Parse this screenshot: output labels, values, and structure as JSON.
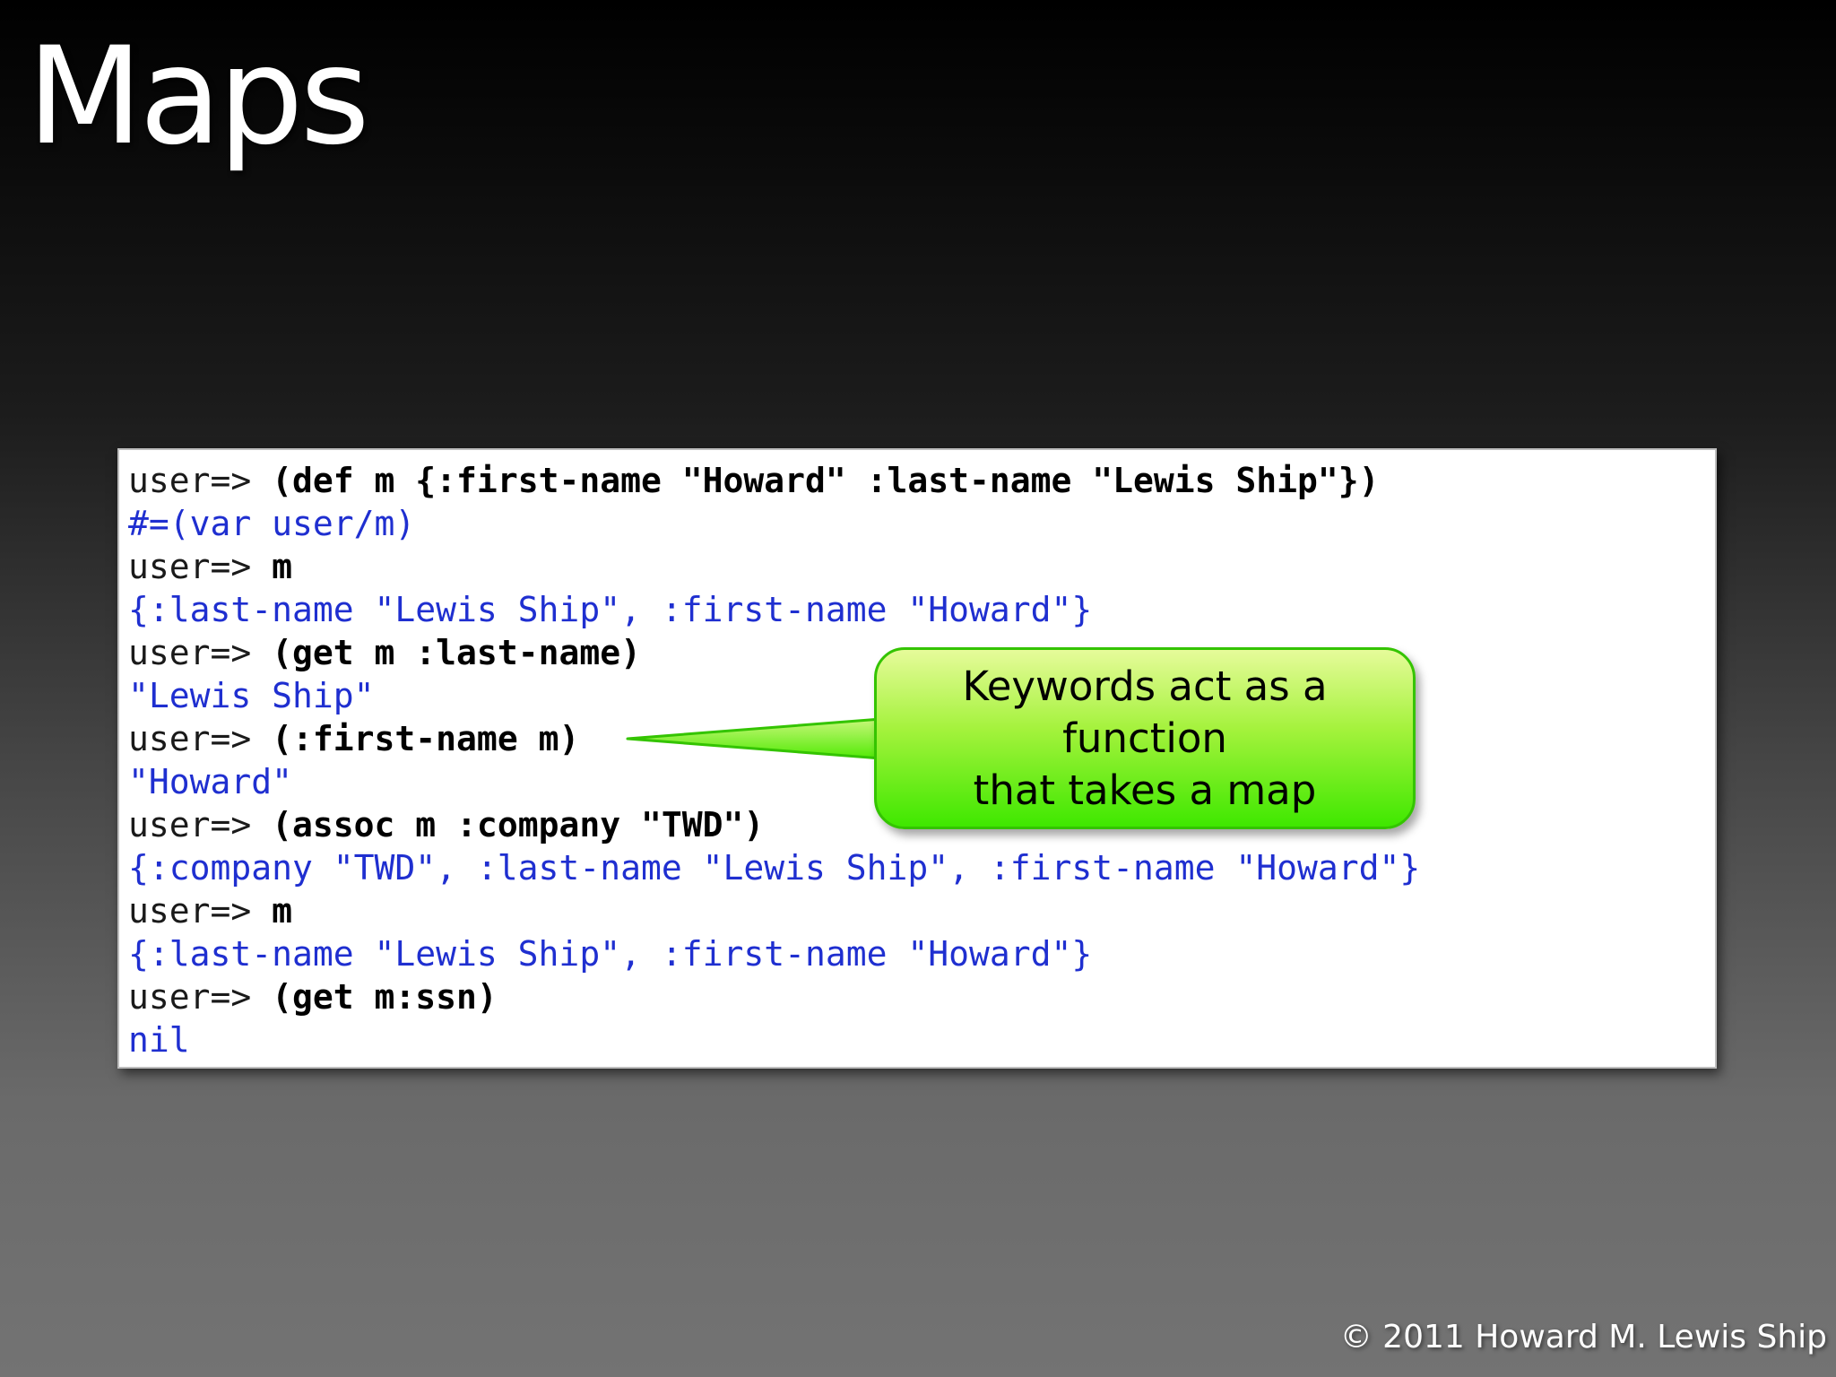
{
  "slide": {
    "title": "Maps",
    "copyright": "© 2011 Howard M. Lewis Ship"
  },
  "colors": {
    "output_text": "#1f2fd0",
    "callout_fill": "#7aef1a",
    "callout_border": "#34c400"
  },
  "code": {
    "lines": [
      {
        "kind": "input",
        "prompt": "user=> ",
        "command": "(def m {:first-name \"Howard\" :last-name \"Lewis Ship\"})"
      },
      {
        "kind": "output",
        "text": "#=(var user/m)"
      },
      {
        "kind": "input",
        "prompt": "user=> ",
        "command": "m"
      },
      {
        "kind": "output",
        "text": "{:last-name \"Lewis Ship\", :first-name \"Howard\"}"
      },
      {
        "kind": "input",
        "prompt": "user=> ",
        "command": "(get m :last-name)"
      },
      {
        "kind": "output",
        "text": "\"Lewis Ship\""
      },
      {
        "kind": "input",
        "prompt": "user=> ",
        "command": "(:first-name m)"
      },
      {
        "kind": "output",
        "text": "\"Howard\""
      },
      {
        "kind": "input",
        "prompt": "user=> ",
        "command": "(assoc m :company \"TWD\")"
      },
      {
        "kind": "output",
        "text": "{:company \"TWD\", :last-name \"Lewis Ship\", :first-name \"Howard\"}"
      },
      {
        "kind": "input",
        "prompt": "user=> ",
        "command": "m"
      },
      {
        "kind": "output",
        "text": "{:last-name \"Lewis Ship\", :first-name \"Howard\"}"
      },
      {
        "kind": "input",
        "prompt": "user=> ",
        "command": "(get m:ssn)"
      },
      {
        "kind": "output",
        "text": "nil"
      }
    ]
  },
  "callout": {
    "line1": "Keywords act as a function",
    "line2": "that takes a map"
  }
}
